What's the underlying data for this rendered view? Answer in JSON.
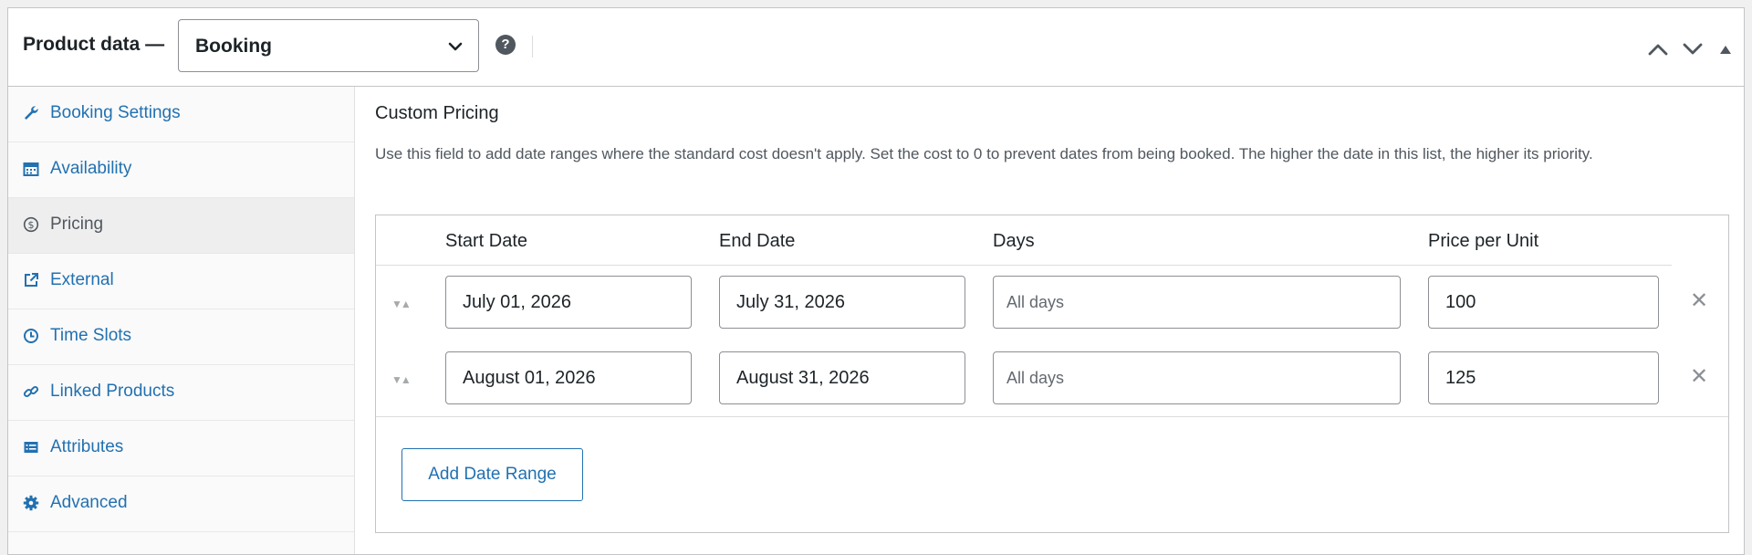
{
  "header": {
    "title": "Product data —",
    "product_type": "Booking",
    "help_icon": "?"
  },
  "sidebar": {
    "items": [
      {
        "label": "Booking Settings",
        "icon": "wrench-icon",
        "active": false
      },
      {
        "label": "Availability",
        "icon": "calendar-icon",
        "active": false
      },
      {
        "label": "Pricing",
        "icon": "dollar-icon",
        "active": true
      },
      {
        "label": "External",
        "icon": "external-link-icon",
        "active": false
      },
      {
        "label": "Time Slots",
        "icon": "clock-icon",
        "active": false
      },
      {
        "label": "Linked Products",
        "icon": "link-icon",
        "active": false
      },
      {
        "label": "Attributes",
        "icon": "list-icon",
        "active": false
      },
      {
        "label": "Advanced",
        "icon": "gear-icon",
        "active": false
      }
    ]
  },
  "pricing": {
    "title": "Custom Pricing",
    "description": "Use this field to add date ranges where the standard cost doesn't apply. Set the cost to 0 to prevent dates from being booked. The higher the date in this list, the higher its priority.",
    "columns": [
      "Start Date",
      "End Date",
      "Days",
      "Price per Unit"
    ],
    "rows": [
      {
        "start": "July 01, 2026",
        "end": "July 31, 2026",
        "days_placeholder": "All days",
        "price": "100"
      },
      {
        "start": "August 01, 2026",
        "end": "August 31, 2026",
        "days_placeholder": "All days",
        "price": "125"
      }
    ],
    "add_button": "Add Date Range"
  },
  "colors": {
    "link": "#2271b1",
    "border": "#c3c4c7",
    "text": "#1d2327"
  }
}
